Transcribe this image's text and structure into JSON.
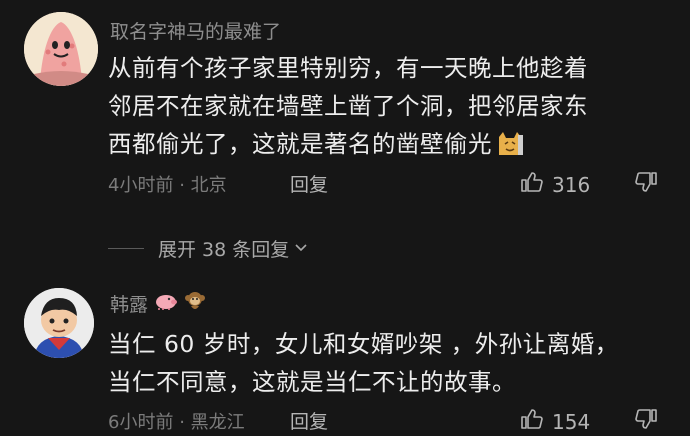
{
  "comments": [
    {
      "username": "取名字神马的最难了",
      "lines": [
        "从前有个孩子家里特别穷，有一天晚上他趁着",
        "邻居不在家就在墙壁上凿了个洞，把邻居家东",
        "西都偷光了，这就是著名的凿壁偷光"
      ],
      "time": "4小时前",
      "location": "北京",
      "reply_label": "回复",
      "likes": "316"
    },
    {
      "username": "韩露",
      "lines": [
        "当仁 60 岁时，女儿和女婿吵架 ，外孙让离婚，",
        "当仁不同意，这就是当仁不让的故事。"
      ],
      "time": "6小时前",
      "location": "黑龙江",
      "reply_label": "回复",
      "likes": "154"
    }
  ],
  "expand_replies": "展开 38 条回复",
  "meta_separator": "·",
  "icons": {
    "like": "thumbs-up-icon",
    "dislike": "thumbs-down-icon",
    "expand": "chevron-down-icon"
  },
  "colors": {
    "background": "#161616",
    "text": "#ededed",
    "muted": "#7b7b7b"
  }
}
